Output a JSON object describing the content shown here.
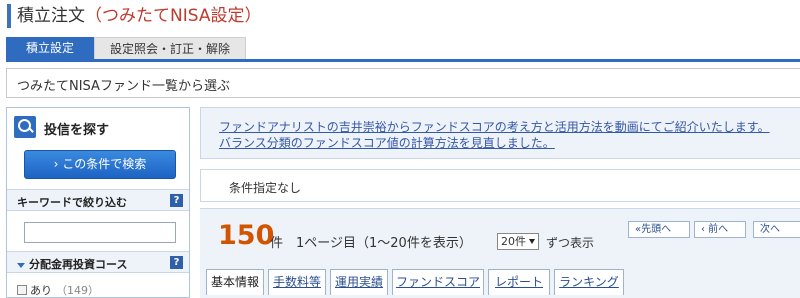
{
  "page_title": {
    "prefix": "積立注文",
    "suffix": "（つみたてNISA設定）"
  },
  "tabs": [
    {
      "label": "積立設定"
    },
    {
      "label": "設定照会・訂正・解除"
    }
  ],
  "fund_select_header": "つみたてNISAファンド一覧から選ぶ",
  "left_panel": {
    "heading": "投信を探す",
    "search_button": "この条件で検索",
    "keyword_section": "キーワードで絞り込む",
    "keyword_value": "",
    "dividend_section": "分配金再投資コース",
    "options": [
      {
        "label": "あり",
        "count": "（149）"
      }
    ]
  },
  "info_links": [
    "ファンドアナリストの吉井崇裕からファンドスコアの考え方と活用方法を動画にてご紹介いたします。",
    "バランス分類のファンドスコア値の計算方法を見直しました。"
  ],
  "condition_text": "条件指定なし",
  "results": {
    "count": "150",
    "count_unit": "件",
    "page_info": "1ページ目（1～20件を表示）",
    "per_page": "20件",
    "per_page_suffix": "ずつ表示",
    "pager": {
      "first": "«先頭へ",
      "prev": "‹ 前へ",
      "next": "次へ"
    }
  },
  "result_tabs": [
    "基本情報",
    "手数料等",
    "運用実績",
    "ファンドスコア",
    "レポート",
    "ランキング"
  ],
  "colors": {
    "accent": "#2f6bbf",
    "highlight": "#d35400",
    "title_red": "#c0392b"
  }
}
